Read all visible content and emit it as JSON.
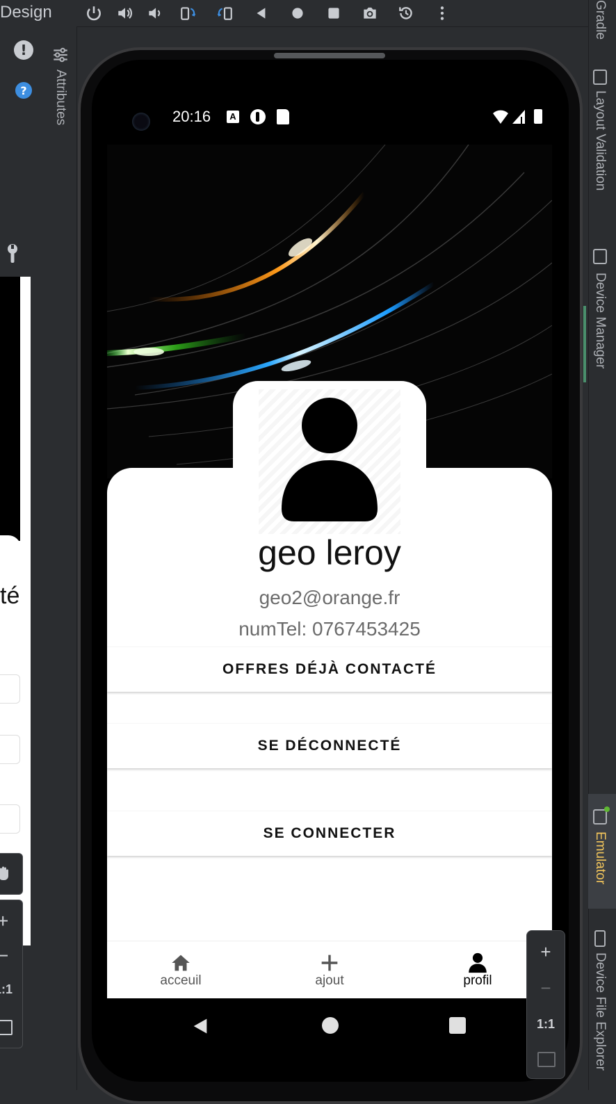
{
  "ide": {
    "design_tab_label": "Design",
    "left_panel_label": "Attributes",
    "right_tools": [
      {
        "label": "Gradle"
      },
      {
        "label": "Layout Validation"
      },
      {
        "label": "Device Manager"
      },
      {
        "label": "Emulator",
        "active": true
      },
      {
        "label": "Device File Explorer"
      }
    ],
    "toolbar_icons": [
      "power-icon",
      "volume-up-icon",
      "volume-down-icon",
      "rotate-left-icon",
      "rotate-right-icon",
      "back-icon",
      "home-icon",
      "overview-icon",
      "camera-icon",
      "snapshot-icon",
      "more-icon"
    ],
    "left_preview_text": "té",
    "zoom": {
      "in": "+",
      "out": "−",
      "one_to_one": "1:1"
    },
    "accent_color": "#f2c55c"
  },
  "status_bar": {
    "time": "20:16"
  },
  "profile": {
    "name": "geo leroy",
    "email": "geo2@orange.fr",
    "phone": "numTel: 0767453425"
  },
  "buttons": {
    "offers": "OFFRES DÉJÀ CONTACTÉ",
    "logout": "SE DÉCONNECTÉ",
    "login": "SE CONNECTER"
  },
  "bottom_nav": [
    {
      "label": "acceuil",
      "icon": "home-icon"
    },
    {
      "label": "ajout",
      "icon": "plus-icon"
    },
    {
      "label": "profil",
      "icon": "person-icon",
      "active": true
    }
  ]
}
